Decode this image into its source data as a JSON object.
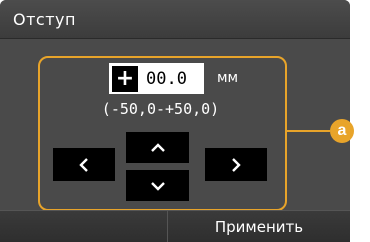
{
  "header": {
    "title": "Отступ"
  },
  "offset": {
    "sign": "+",
    "value": "00.0",
    "unit": "мм",
    "range": "(-50,0-+50,0)"
  },
  "buttons": {
    "left_icon": "chevron-left-icon",
    "right_icon": "chevron-right-icon",
    "up_icon": "chevron-up-icon",
    "down_icon": "chevron-down-icon"
  },
  "footer": {
    "apply_label": "Применить"
  },
  "callout": {
    "label": "a"
  },
  "colors": {
    "accent": "#e8a42a",
    "screen_bg": "#4a4a4a",
    "button_bg": "#000000"
  }
}
